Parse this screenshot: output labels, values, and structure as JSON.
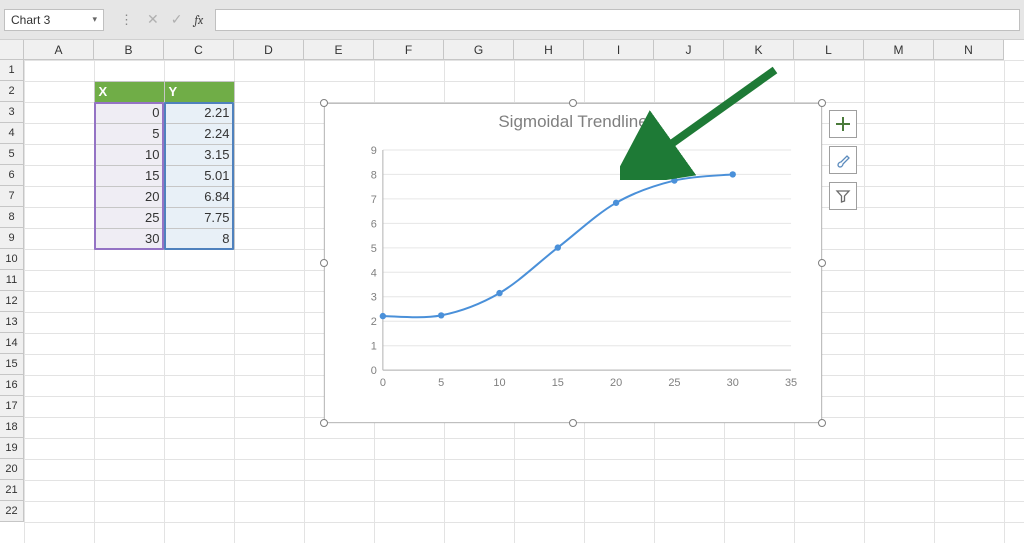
{
  "name_box": {
    "value": "Chart 3"
  },
  "formula_bar": {
    "fx_label": "fx",
    "value": ""
  },
  "columns": [
    "A",
    "B",
    "C",
    "D",
    "E",
    "F",
    "G",
    "H",
    "I",
    "J",
    "K",
    "L",
    "M",
    "N"
  ],
  "rows": [
    "1",
    "2",
    "3",
    "4",
    "5",
    "6",
    "7",
    "8",
    "9",
    "10",
    "11",
    "12",
    "13",
    "14",
    "15",
    "16",
    "17",
    "18",
    "19",
    "20",
    "21",
    "22"
  ],
  "table": {
    "headers": {
      "x": "X",
      "y": "Y"
    },
    "rows": [
      {
        "x": "0",
        "y": "2.21"
      },
      {
        "x": "5",
        "y": "2.24"
      },
      {
        "x": "10",
        "y": "3.15"
      },
      {
        "x": "15",
        "y": "5.01"
      },
      {
        "x": "20",
        "y": "6.84"
      },
      {
        "x": "25",
        "y": "7.75"
      },
      {
        "x": "30",
        "y": "8"
      }
    ]
  },
  "chart_data": {
    "type": "line",
    "title": "Sigmoidal Trendline",
    "xlabel": "",
    "ylabel": "",
    "xlim": [
      0,
      35
    ],
    "ylim": [
      0,
      9
    ],
    "xticks": [
      0,
      5,
      10,
      15,
      20,
      25,
      30,
      35
    ],
    "yticks": [
      0,
      1,
      2,
      3,
      4,
      5,
      6,
      7,
      8,
      9
    ],
    "x": [
      0,
      5,
      10,
      15,
      20,
      25,
      30
    ],
    "values": [
      2.21,
      2.24,
      3.15,
      5.01,
      6.84,
      7.75,
      8.0
    ]
  },
  "side_buttons": {
    "plus": "+",
    "brush": "🖌",
    "filter": "⏷"
  }
}
